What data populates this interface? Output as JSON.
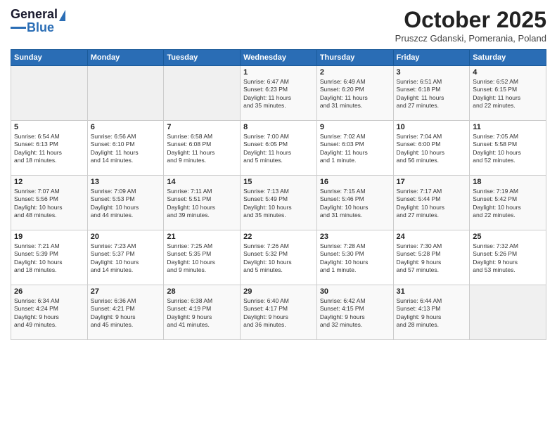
{
  "header": {
    "logo_general": "General",
    "logo_blue": "Blue",
    "month_title": "October 2025",
    "subtitle": "Pruszcz Gdanski, Pomerania, Poland"
  },
  "days_of_week": [
    "Sunday",
    "Monday",
    "Tuesday",
    "Wednesday",
    "Thursday",
    "Friday",
    "Saturday"
  ],
  "weeks": [
    [
      {
        "day": "",
        "info": ""
      },
      {
        "day": "",
        "info": ""
      },
      {
        "day": "",
        "info": ""
      },
      {
        "day": "1",
        "info": "Sunrise: 6:47 AM\nSunset: 6:23 PM\nDaylight: 11 hours\nand 35 minutes."
      },
      {
        "day": "2",
        "info": "Sunrise: 6:49 AM\nSunset: 6:20 PM\nDaylight: 11 hours\nand 31 minutes."
      },
      {
        "day": "3",
        "info": "Sunrise: 6:51 AM\nSunset: 6:18 PM\nDaylight: 11 hours\nand 27 minutes."
      },
      {
        "day": "4",
        "info": "Sunrise: 6:52 AM\nSunset: 6:15 PM\nDaylight: 11 hours\nand 22 minutes."
      }
    ],
    [
      {
        "day": "5",
        "info": "Sunrise: 6:54 AM\nSunset: 6:13 PM\nDaylight: 11 hours\nand 18 minutes."
      },
      {
        "day": "6",
        "info": "Sunrise: 6:56 AM\nSunset: 6:10 PM\nDaylight: 11 hours\nand 14 minutes."
      },
      {
        "day": "7",
        "info": "Sunrise: 6:58 AM\nSunset: 6:08 PM\nDaylight: 11 hours\nand 9 minutes."
      },
      {
        "day": "8",
        "info": "Sunrise: 7:00 AM\nSunset: 6:05 PM\nDaylight: 11 hours\nand 5 minutes."
      },
      {
        "day": "9",
        "info": "Sunrise: 7:02 AM\nSunset: 6:03 PM\nDaylight: 11 hours\nand 1 minute."
      },
      {
        "day": "10",
        "info": "Sunrise: 7:04 AM\nSunset: 6:00 PM\nDaylight: 10 hours\nand 56 minutes."
      },
      {
        "day": "11",
        "info": "Sunrise: 7:05 AM\nSunset: 5:58 PM\nDaylight: 10 hours\nand 52 minutes."
      }
    ],
    [
      {
        "day": "12",
        "info": "Sunrise: 7:07 AM\nSunset: 5:56 PM\nDaylight: 10 hours\nand 48 minutes."
      },
      {
        "day": "13",
        "info": "Sunrise: 7:09 AM\nSunset: 5:53 PM\nDaylight: 10 hours\nand 44 minutes."
      },
      {
        "day": "14",
        "info": "Sunrise: 7:11 AM\nSunset: 5:51 PM\nDaylight: 10 hours\nand 39 minutes."
      },
      {
        "day": "15",
        "info": "Sunrise: 7:13 AM\nSunset: 5:49 PM\nDaylight: 10 hours\nand 35 minutes."
      },
      {
        "day": "16",
        "info": "Sunrise: 7:15 AM\nSunset: 5:46 PM\nDaylight: 10 hours\nand 31 minutes."
      },
      {
        "day": "17",
        "info": "Sunrise: 7:17 AM\nSunset: 5:44 PM\nDaylight: 10 hours\nand 27 minutes."
      },
      {
        "day": "18",
        "info": "Sunrise: 7:19 AM\nSunset: 5:42 PM\nDaylight: 10 hours\nand 22 minutes."
      }
    ],
    [
      {
        "day": "19",
        "info": "Sunrise: 7:21 AM\nSunset: 5:39 PM\nDaylight: 10 hours\nand 18 minutes."
      },
      {
        "day": "20",
        "info": "Sunrise: 7:23 AM\nSunset: 5:37 PM\nDaylight: 10 hours\nand 14 minutes."
      },
      {
        "day": "21",
        "info": "Sunrise: 7:25 AM\nSunset: 5:35 PM\nDaylight: 10 hours\nand 9 minutes."
      },
      {
        "day": "22",
        "info": "Sunrise: 7:26 AM\nSunset: 5:32 PM\nDaylight: 10 hours\nand 5 minutes."
      },
      {
        "day": "23",
        "info": "Sunrise: 7:28 AM\nSunset: 5:30 PM\nDaylight: 10 hours\nand 1 minute."
      },
      {
        "day": "24",
        "info": "Sunrise: 7:30 AM\nSunset: 5:28 PM\nDaylight: 9 hours\nand 57 minutes."
      },
      {
        "day": "25",
        "info": "Sunrise: 7:32 AM\nSunset: 5:26 PM\nDaylight: 9 hours\nand 53 minutes."
      }
    ],
    [
      {
        "day": "26",
        "info": "Sunrise: 6:34 AM\nSunset: 4:24 PM\nDaylight: 9 hours\nand 49 minutes."
      },
      {
        "day": "27",
        "info": "Sunrise: 6:36 AM\nSunset: 4:21 PM\nDaylight: 9 hours\nand 45 minutes."
      },
      {
        "day": "28",
        "info": "Sunrise: 6:38 AM\nSunset: 4:19 PM\nDaylight: 9 hours\nand 41 minutes."
      },
      {
        "day": "29",
        "info": "Sunrise: 6:40 AM\nSunset: 4:17 PM\nDaylight: 9 hours\nand 36 minutes."
      },
      {
        "day": "30",
        "info": "Sunrise: 6:42 AM\nSunset: 4:15 PM\nDaylight: 9 hours\nand 32 minutes."
      },
      {
        "day": "31",
        "info": "Sunrise: 6:44 AM\nSunset: 4:13 PM\nDaylight: 9 hours\nand 28 minutes."
      },
      {
        "day": "",
        "info": ""
      }
    ]
  ]
}
